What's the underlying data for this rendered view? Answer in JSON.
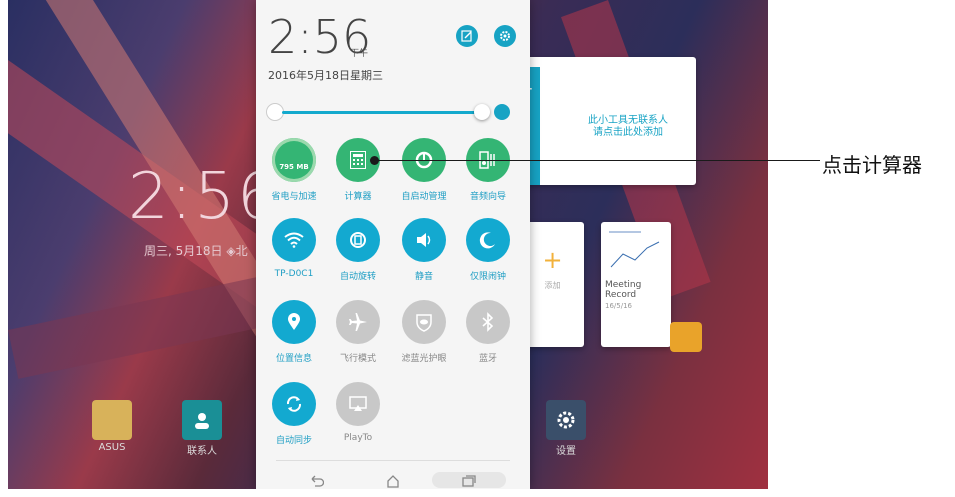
{
  "annotation": {
    "text": "点击计算器"
  },
  "home": {
    "clock": "2:56",
    "date": "周三, 5月18日 ◈北",
    "dock": [
      {
        "label": "ASUS",
        "icon": "folder-icon"
      },
      {
        "label": "联系人",
        "icon": "contacts-icon"
      },
      {
        "label": "设置",
        "icon": "gear-icon"
      }
    ],
    "widget_contacts": {
      "line1": "此小工具无联系人",
      "line2": "请点击此处添加"
    },
    "widget_add": {
      "label": "添加"
    },
    "widget_note": {
      "title": "Meeting Record",
      "date": "16/5/16"
    }
  },
  "panel": {
    "time": "2:56",
    "ampm": "下午",
    "date": "2016年5月18日星期三",
    "storage": "795 MB",
    "tiles": [
      {
        "label": "省电与加速",
        "icon": "broom-icon",
        "state": "on"
      },
      {
        "label": "计算器",
        "icon": "calculator-icon",
        "state": "on"
      },
      {
        "label": "自启动管理",
        "icon": "auto-start-icon",
        "state": "on"
      },
      {
        "label": "音频向导",
        "icon": "audio-wizard-icon",
        "state": "on"
      },
      {
        "label": "TP-D0C1",
        "icon": "wifi-icon",
        "state": "on"
      },
      {
        "label": "自动旋转",
        "icon": "rotate-icon",
        "state": "on"
      },
      {
        "label": "静音",
        "icon": "mute-icon",
        "state": "on"
      },
      {
        "label": "仅限闹钟",
        "icon": "moon-icon",
        "state": "on"
      },
      {
        "label": "位置信息",
        "icon": "location-icon",
        "state": "on"
      },
      {
        "label": "飞行模式",
        "icon": "airplane-icon",
        "state": "off"
      },
      {
        "label": "滤蓝光护眼",
        "icon": "eye-care-icon",
        "state": "off"
      },
      {
        "label": "蓝牙",
        "icon": "bluetooth-icon",
        "state": "off"
      },
      {
        "label": "自动同步",
        "icon": "sync-icon",
        "state": "on"
      },
      {
        "label": "PlayTo",
        "icon": "cast-icon",
        "state": "off"
      }
    ]
  }
}
